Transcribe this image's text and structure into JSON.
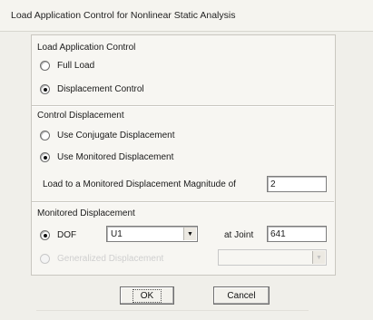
{
  "window": {
    "title": "Load Application Control for Nonlinear Static Analysis"
  },
  "load_application_control": {
    "heading": "Load Application Control",
    "options": [
      {
        "label": "Full Load",
        "selected": false
      },
      {
        "label": "Displacement Control",
        "selected": true
      }
    ]
  },
  "control_displacement": {
    "heading": "Control Displacement",
    "options": [
      {
        "label": "Use Conjugate Displacement",
        "selected": false
      },
      {
        "label": "Use Monitored Displacement",
        "selected": true
      }
    ],
    "magnitude_label": "Load to a Monitored Displacement Magnitude of",
    "magnitude_value": "2"
  },
  "monitored_displacement": {
    "heading": "Monitored Displacement",
    "dof": {
      "label": "DOF",
      "selected": true,
      "value": "U1"
    },
    "joint_label": "at Joint",
    "joint_value": "641",
    "generalized": {
      "label": "Generalized Displacement",
      "selected": false,
      "enabled": false,
      "value": ""
    }
  },
  "buttons": {
    "ok": "OK",
    "cancel": "Cancel"
  }
}
